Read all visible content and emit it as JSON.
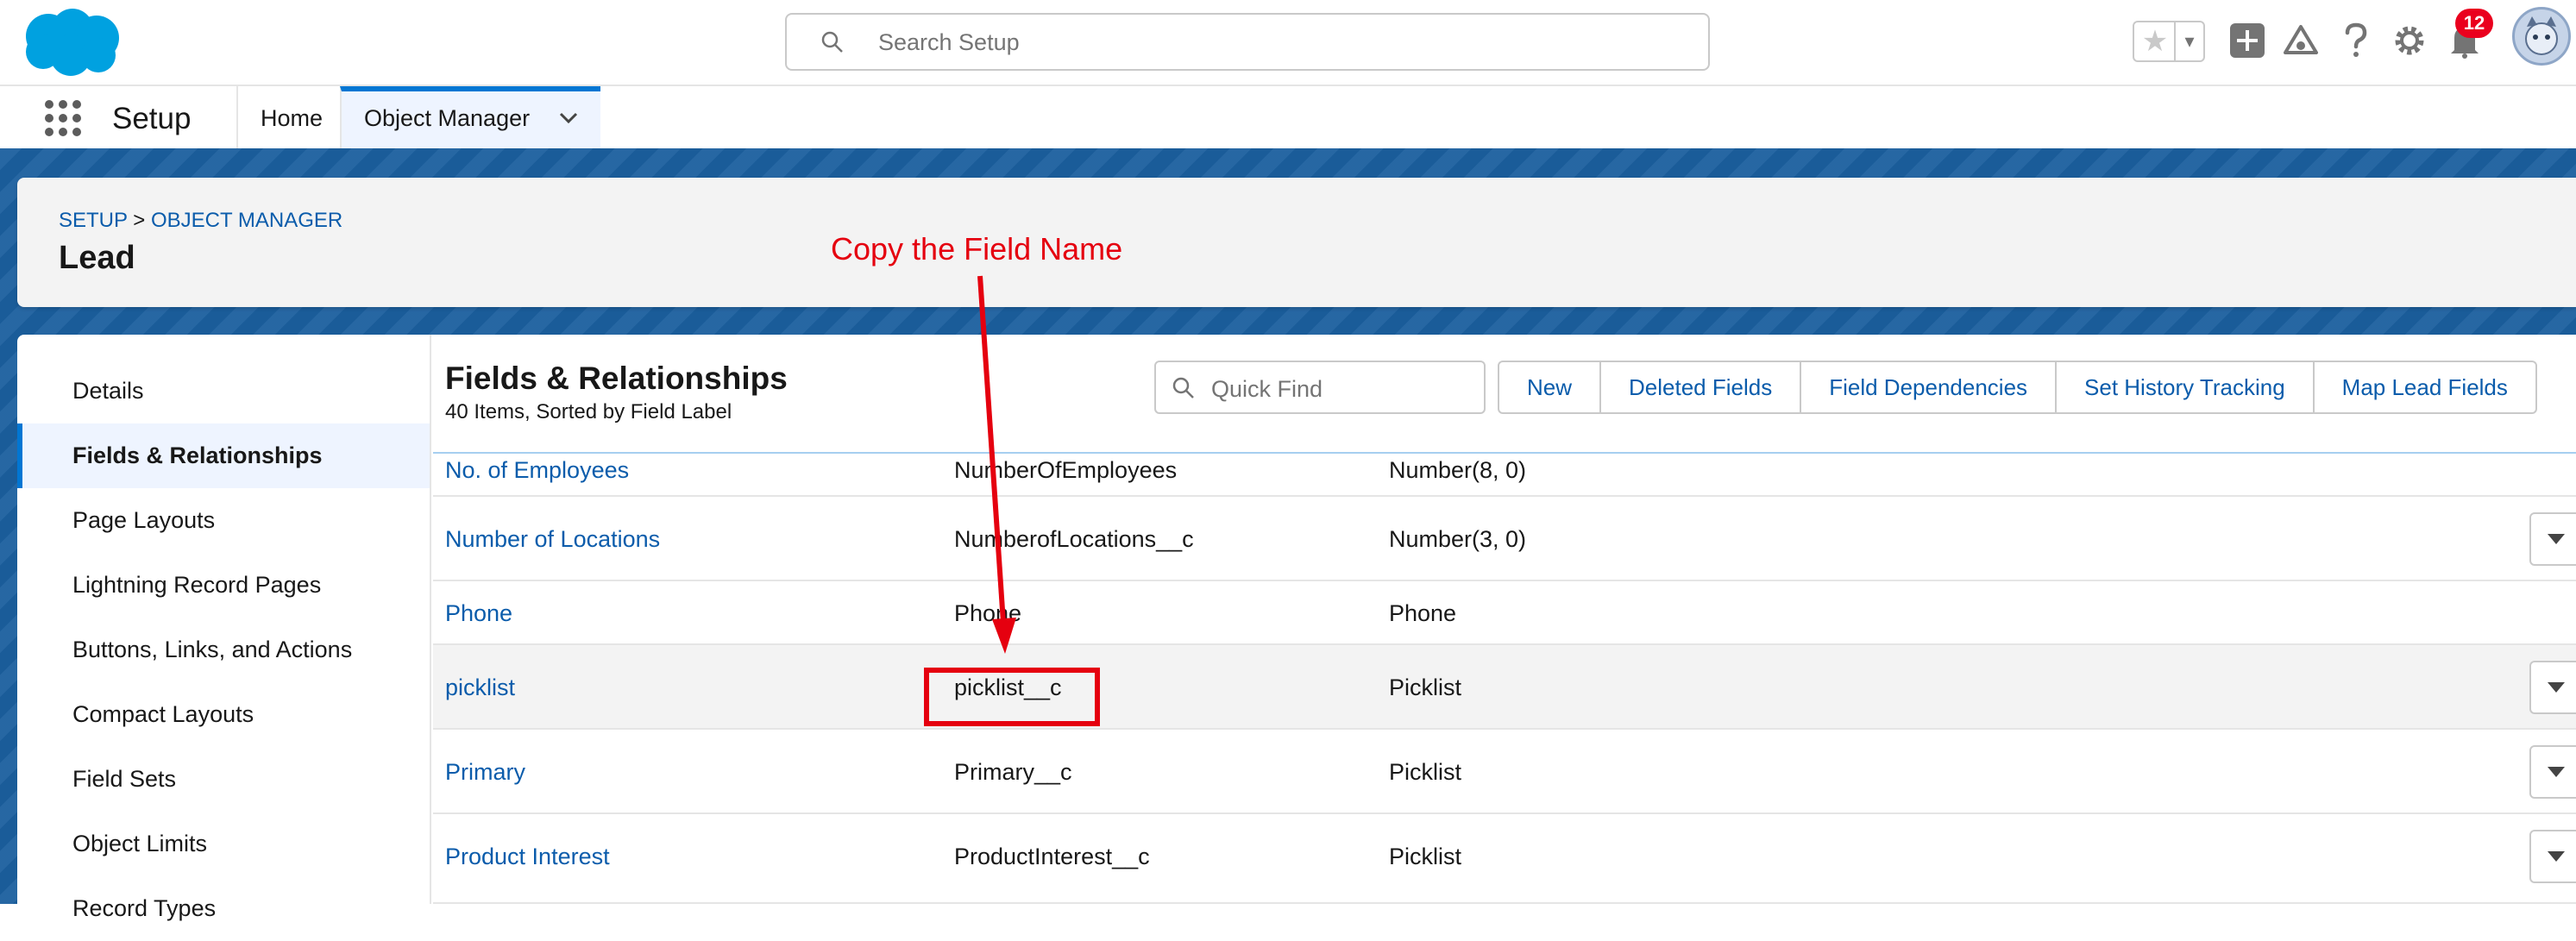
{
  "header": {
    "search_placeholder": "Search Setup",
    "notification_count": "12",
    "icons": [
      "favorites-star-icon",
      "add-icon",
      "trailhead-icon",
      "help-icon",
      "setup-gear-icon",
      "notifications-bell-icon"
    ]
  },
  "context_bar": {
    "app_name": "Setup",
    "tabs": [
      {
        "label": "Home"
      },
      {
        "label": "Object Manager"
      }
    ]
  },
  "object_header": {
    "breadcrumb_setup": "SETUP",
    "breadcrumb_sep": ">",
    "breadcrumb_object_manager": "OBJECT MANAGER",
    "title": "Lead"
  },
  "sidebar": {
    "items": [
      {
        "label": "Details"
      },
      {
        "label": "Fields & Relationships"
      },
      {
        "label": "Page Layouts"
      },
      {
        "label": "Lightning Record Pages"
      },
      {
        "label": "Buttons, Links, and Actions"
      },
      {
        "label": "Compact Layouts"
      },
      {
        "label": "Field Sets"
      },
      {
        "label": "Object Limits"
      },
      {
        "label": "Record Types"
      }
    ],
    "active": "Fields & Relationships"
  },
  "content": {
    "title": "Fields & Relationships",
    "subtitle": "40 Items, Sorted by Field Label",
    "quick_find_placeholder": "Quick Find",
    "buttons": [
      "New",
      "Deleted Fields",
      "Field Dependencies",
      "Set History Tracking",
      "Map Lead Fields"
    ]
  },
  "table": {
    "rows": [
      {
        "label": "No. of Employees",
        "api_name": "NumberOfEmployees",
        "type": "Number(8, 0)",
        "has_menu": false
      },
      {
        "label": "Number of Locations",
        "api_name": "NumberofLocations__c",
        "type": "Number(3, 0)",
        "has_menu": true
      },
      {
        "label": "Phone",
        "api_name": "Phone",
        "type": "Phone",
        "has_menu": false
      },
      {
        "label": "picklist",
        "api_name": "picklist__c",
        "type": "Picklist",
        "has_menu": true
      },
      {
        "label": "Primary",
        "api_name": "Primary__c",
        "type": "Picklist",
        "has_menu": true
      },
      {
        "label": "Product Interest",
        "api_name": "ProductInterest__c",
        "type": "Picklist",
        "has_menu": true
      }
    ]
  },
  "annotation": {
    "text": "Copy the Field Name",
    "color": "#e5000f"
  },
  "colors": {
    "brand": "#0176d3",
    "link": "#0b5cab",
    "banner": "#1b5f9e"
  }
}
